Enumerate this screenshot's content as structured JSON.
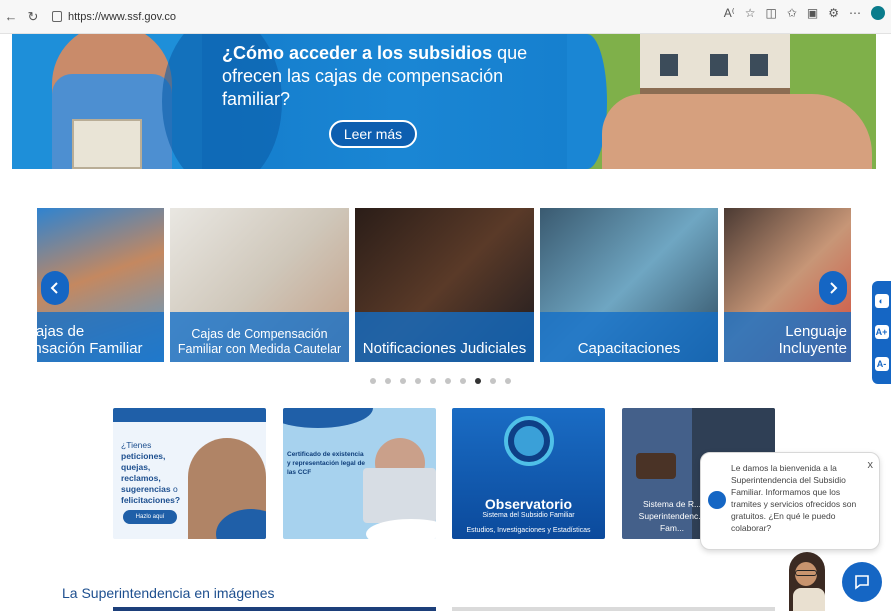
{
  "browser": {
    "url": "https://www.ssf.gov.co",
    "icons": [
      "back-icon",
      "refresh-icon",
      "read-aloud-icon",
      "favorite-icon",
      "split-screen-icon",
      "favorites-bar-icon",
      "collections-icon",
      "extensions-icon",
      "more-icon",
      "profile-icon"
    ]
  },
  "hero": {
    "title_bold": "¿Cómo acceder a los subsidios",
    "title_rest": " que ofrecen las cajas de compensación familiar?",
    "button_label": "Leer más"
  },
  "carousel": {
    "slides": [
      {
        "label": "Cajas de\nensación Familiar"
      },
      {
        "label": "Cajas de Compensación Familiar con Medida Cautelar"
      },
      {
        "label": "Notificaciones Judiciales"
      },
      {
        "label": "Capacitaciones"
      },
      {
        "label": "Lenguaje Incluyente"
      }
    ],
    "dot_count": 10,
    "active_dot": 7
  },
  "cards": {
    "card1": {
      "line1": "¿Tienes",
      "line2": "peticiones,",
      "line3": "quejas, reclamos,",
      "line4": "sugerencias",
      "line4b": " o",
      "line5": "felicitaciones?",
      "button": "Hazlo aquí"
    },
    "card2": {
      "text": "Certificado de existencia y representación legal de las CCF"
    },
    "card3": {
      "title": "Observatorio",
      "subtitle": "Sistema del Subsidio Familiar",
      "footer": "Estudios, Investigaciones y Estadísticas"
    },
    "card4": {
      "text": "Sistema de R... Superintendenc... Fam..."
    }
  },
  "section": {
    "title": "La Superintendencia en imágenes"
  },
  "accessibility": {
    "buttons": [
      "◐",
      "A+",
      "A-"
    ]
  },
  "chat": {
    "message": "Le damos la bienvenida a la Superintendencia del Subsidio Familiar. Informamos que los tramites y servicios ofrecidos son gratuitos. ¿En qué le puedo colaborar?",
    "close": "x"
  },
  "colors": {
    "brand_blue": "#1566c4",
    "dark_blue": "#1d4f8f"
  }
}
